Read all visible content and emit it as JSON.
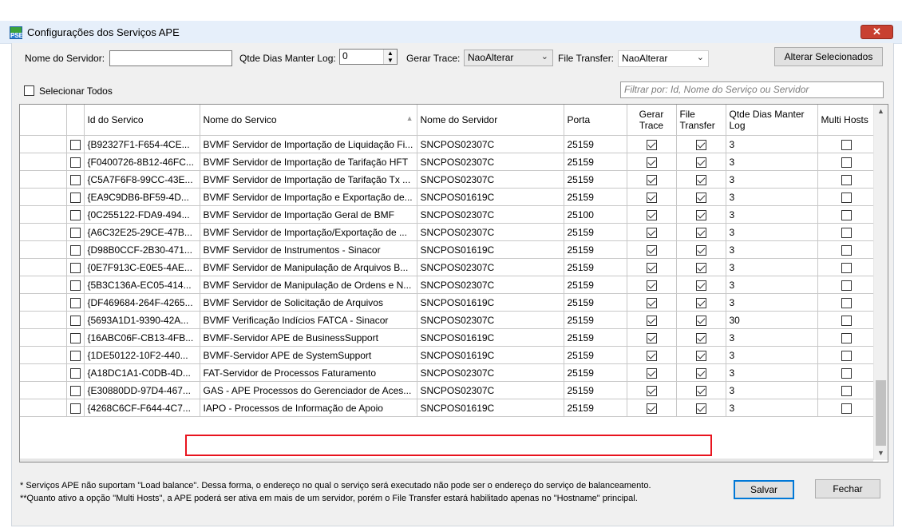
{
  "window": {
    "title": "Configurações dos Serviços APE",
    "close_label": "✕"
  },
  "toolbar": {
    "servidor_label": "Nome do Servidor:",
    "servidor_value": "",
    "dias_label": "Qtde Dias Manter Log:",
    "dias_value": "0",
    "trace_label": "Gerar Trace:",
    "trace_value": "NaoAlterar",
    "file_label": "File Transfer:",
    "file_value": "NaoAlterar",
    "alterar_label": "Alterar Selecionados"
  },
  "select_all_label": "Selecionar Todos",
  "filter_placeholder": "Filtrar por: Id, Nome do Serviço ou Servidor",
  "grid": {
    "headers": {
      "id": "Id do Servico",
      "nome": "Nome do Servico",
      "servidor": "Nome do Servidor",
      "porta": "Porta",
      "trace": "Gerar Trace",
      "file": "File Transfer",
      "dias": "Qtde Dias Manter Log",
      "multi": "Multi Hosts"
    },
    "rows": [
      {
        "id": "{B92327F1-F654-4CE...",
        "nome": "BVMF Servidor de Importação de Liquidação Fi...",
        "servidor": "SNCPOS02307C",
        "porta": "25159",
        "dias": "3"
      },
      {
        "id": "{F0400726-8B12-46FC...",
        "nome": "BVMF Servidor de Importação de Tarifação HFT",
        "servidor": "SNCPOS02307C",
        "porta": "25159",
        "dias": "3"
      },
      {
        "id": "{C5A7F6F8-99CC-43E...",
        "nome": "BVMF Servidor de Importação de Tarifação Tx ...",
        "servidor": "SNCPOS02307C",
        "porta": "25159",
        "dias": "3"
      },
      {
        "id": "{EA9C9DB6-BF59-4D...",
        "nome": "BVMF Servidor de Importação e Exportação de...",
        "servidor": "SNCPOS01619C",
        "porta": "25159",
        "dias": "3"
      },
      {
        "id": "{0C255122-FDA9-494...",
        "nome": "BVMF Servidor de Importação Geral de BMF",
        "servidor": "SNCPOS02307C",
        "porta": "25100",
        "dias": "3"
      },
      {
        "id": "{A6C32E25-29CE-47B...",
        "nome": "BVMF Servidor de Importação/Exportação de ...",
        "servidor": "SNCPOS02307C",
        "porta": "25159",
        "dias": "3"
      },
      {
        "id": "{D98B0CCF-2B30-471...",
        "nome": "BVMF Servidor de Instrumentos - Sinacor",
        "servidor": "SNCPOS01619C",
        "porta": "25159",
        "dias": "3"
      },
      {
        "id": "{0E7F913C-E0E5-4AE...",
        "nome": "BVMF Servidor de Manipulação de Arquivos B...",
        "servidor": "SNCPOS02307C",
        "porta": "25159",
        "dias": "3"
      },
      {
        "id": "{5B3C136A-EC05-414...",
        "nome": "BVMF Servidor de Manipulação de Ordens e N...",
        "servidor": "SNCPOS02307C",
        "porta": "25159",
        "dias": "3"
      },
      {
        "id": "{DF469684-264F-4265...",
        "nome": "BVMF Servidor de Solicitação de Arquivos",
        "servidor": "SNCPOS01619C",
        "porta": "25159",
        "dias": "3"
      },
      {
        "id": "{5693A1D1-9390-42A...",
        "nome": "BVMF Verificação Indícios FATCA - Sinacor",
        "servidor": "SNCPOS02307C",
        "porta": "25159",
        "dias": "30"
      },
      {
        "id": "{16ABC06F-CB13-4FB...",
        "nome": "BVMF-Servidor APE de BusinessSupport",
        "servidor": "SNCPOS01619C",
        "porta": "25159",
        "dias": "3"
      },
      {
        "id": "{1DE50122-10F2-440...",
        "nome": "BVMF-Servidor APE de SystemSupport",
        "servidor": "SNCPOS01619C",
        "porta": "25159",
        "dias": "3"
      },
      {
        "id": "{A18DC1A1-C0DB-4D...",
        "nome": "FAT-Servidor de Processos Faturamento",
        "servidor": "SNCPOS02307C",
        "porta": "25159",
        "dias": "3"
      },
      {
        "id": "{E30880DD-97D4-467...",
        "nome": "GAS - APE Processos do Gerenciador de Aces...",
        "servidor": "SNCPOS02307C",
        "porta": "25159",
        "dias": "3"
      },
      {
        "id": "{4268C6CF-F644-4C7...",
        "nome": "IAPO - Processos de Informação de Apoio",
        "servidor": "SNCPOS01619C",
        "porta": "25159",
        "dias": "3"
      }
    ]
  },
  "footer": {
    "note1": "* Serviços APE não suportam \"Load balance\". Dessa forma, o endereço no qual o serviço será executado não pode ser o endereço do serviço de balanceamento.",
    "note2": "**Quanto ativo a opção \"Multi Hosts\", a APE poderá ser ativa em mais de um servidor, porém o File Transfer estará habilitado apenas no \"Hostname\" principal.",
    "save_label": "Salvar",
    "close_label": "Fechar"
  }
}
